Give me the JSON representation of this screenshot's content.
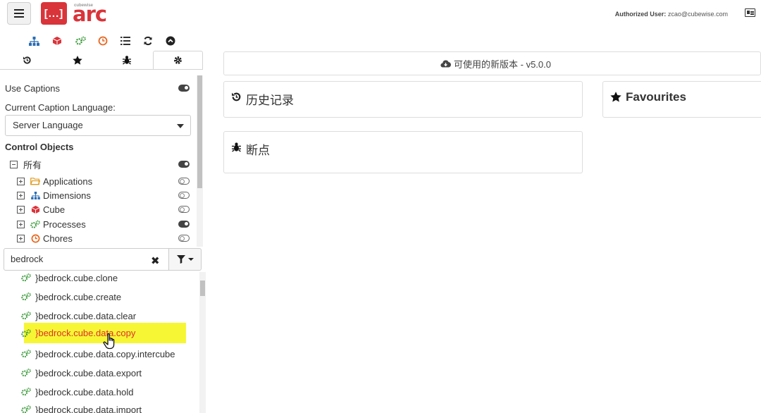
{
  "header": {
    "logo_mark": "[...]",
    "logo_brand": "cubewise",
    "logo_name": "arc",
    "auth_label": "Authorized User:",
    "auth_user": "zcao@cubewise.com"
  },
  "toolbar": {
    "icons": [
      "sitemap-icon",
      "cube-icon",
      "cogs-icon",
      "clock-icon",
      "list-icon",
      "refresh-icon",
      "chevron-circle-up-icon"
    ]
  },
  "tabs": [
    "history-icon",
    "star-icon",
    "bug-icon",
    "gear-icon"
  ],
  "settings": {
    "use_captions": "Use Captions",
    "caption_language_label": "Current Caption Language:",
    "caption_language_value": "Server Language",
    "control_objects": "Control Objects",
    "all": "所有",
    "tree": [
      {
        "label": "Applications",
        "icon": "folder-icon",
        "toggle": "off"
      },
      {
        "label": "Dimensions",
        "icon": "sitemap-icon",
        "toggle": "off"
      },
      {
        "label": "Cube",
        "icon": "cube-icon",
        "toggle": "off"
      },
      {
        "label": "Processes",
        "icon": "cogs-icon",
        "toggle": "on"
      },
      {
        "label": "Chores",
        "icon": "clock-icon",
        "toggle": "off"
      }
    ]
  },
  "search": {
    "value": "bedrock",
    "clear": "✖"
  },
  "results": [
    "}bedrock.cube.clone",
    "}bedrock.cube.create",
    "}bedrock.cube.data.clear",
    "}bedrock.cube.data.copy",
    "}bedrock.cube.data.copy.intercube",
    "}bedrock.cube.data.export",
    "}bedrock.cube.data.hold",
    "}bedrock.cube.data.import"
  ],
  "main": {
    "update_text": "可使用的新版本 - v5.0.0",
    "history_title": "历史记录",
    "favourites_title": "Favourites",
    "breakpoints_title": "断点"
  },
  "colors": {
    "brand_red": "#d9343a",
    "process_green": "#3a9a3a",
    "highlight_yellow": "#f6f634"
  }
}
